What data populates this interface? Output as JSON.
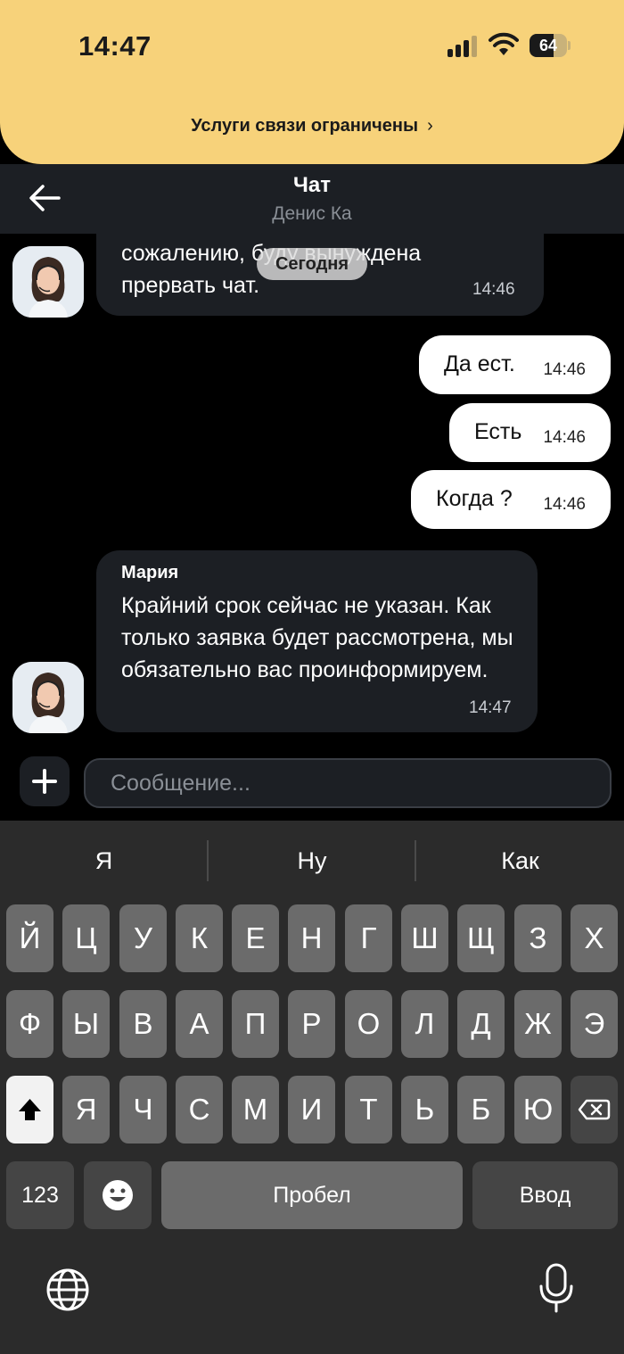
{
  "status_bar": {
    "time": "14:47",
    "battery_level": "64",
    "icons": [
      "signal-icon",
      "wifi-icon",
      "battery-icon"
    ]
  },
  "banner": {
    "text": "Услуги связи ограничены",
    "chevron": "›"
  },
  "header": {
    "title": "Чат",
    "subtitle": "Денис Ка",
    "back_icon": "arrow-left-icon"
  },
  "chat": {
    "date_label": "Сегодня",
    "messages": [
      {
        "direction": "in",
        "text": "сожалению, буду вынуждена прервать чат.",
        "time": "14:46"
      },
      {
        "direction": "out",
        "text": "Да ест.",
        "time": "14:46"
      },
      {
        "direction": "out",
        "text": "Есть",
        "time": "14:46"
      },
      {
        "direction": "out",
        "text": "Когда ?",
        "time": "14:46"
      },
      {
        "direction": "in",
        "sender": "Мария",
        "text": "Крайний срок сейчас не указан. Как только заявка будет рассмотрена, мы обязательно вас проинформируем.",
        "time": "14:47"
      }
    ]
  },
  "composer": {
    "placeholder": "Сообщение..."
  },
  "keyboard": {
    "suggestions": [
      "Я",
      "Ну",
      "Как"
    ],
    "row1": [
      "Й",
      "Ц",
      "У",
      "К",
      "Е",
      "Н",
      "Г",
      "Ш",
      "Щ",
      "З",
      "Х"
    ],
    "row2": [
      "Ф",
      "Ы",
      "В",
      "А",
      "П",
      "Р",
      "О",
      "Л",
      "Д",
      "Ж",
      "Э"
    ],
    "row3": [
      "Я",
      "Ч",
      "С",
      "М",
      "И",
      "Т",
      "Ь",
      "Б",
      "Ю"
    ],
    "numbers_label": "123",
    "space_label": "Пробел",
    "return_label": "Ввод"
  },
  "colors": {
    "banner": "#f7d27a",
    "header": "#1c1f24",
    "incoming_bubble": "#1c1f24",
    "outgoing_bubble": "#ffffff",
    "keyboard": "#2b2b2b"
  }
}
